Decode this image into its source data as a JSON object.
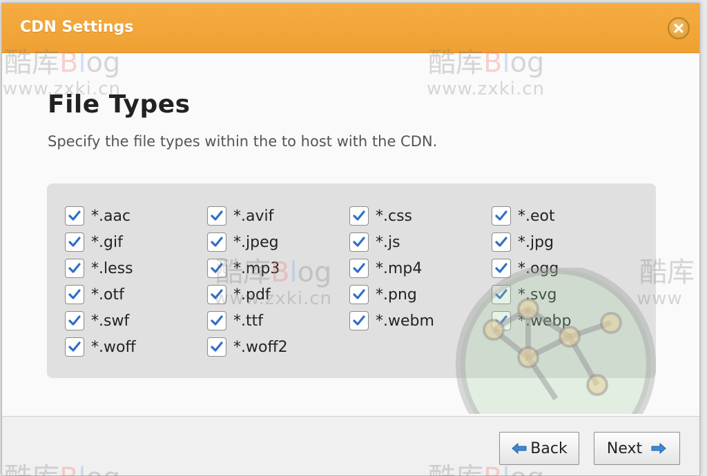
{
  "dialog": {
    "title": "CDN Settings",
    "close_icon": "close-icon"
  },
  "main": {
    "heading": "File Types",
    "description": "Specify the file types within the to host with the CDN."
  },
  "file_types": [
    {
      "label": "*.aac",
      "checked": true
    },
    {
      "label": "*.avif",
      "checked": true
    },
    {
      "label": "*.css",
      "checked": true
    },
    {
      "label": "*.eot",
      "checked": true
    },
    {
      "label": "*.gif",
      "checked": true
    },
    {
      "label": "*.jpeg",
      "checked": true
    },
    {
      "label": "*.js",
      "checked": true
    },
    {
      "label": "*.jpg",
      "checked": true
    },
    {
      "label": "*.less",
      "checked": true
    },
    {
      "label": "*.mp3",
      "checked": true
    },
    {
      "label": "*.mp4",
      "checked": true
    },
    {
      "label": "*.ogg",
      "checked": true
    },
    {
      "label": "*.otf",
      "checked": true
    },
    {
      "label": "*.pdf",
      "checked": true
    },
    {
      "label": "*.png",
      "checked": true
    },
    {
      "label": "*.svg",
      "checked": true
    },
    {
      "label": "*.swf",
      "checked": true
    },
    {
      "label": "*.ttf",
      "checked": true
    },
    {
      "label": "*.webm",
      "checked": true
    },
    {
      "label": "*.webp",
      "checked": true
    },
    {
      "label": "*.woff",
      "checked": true
    },
    {
      "label": "*.woff2",
      "checked": true
    }
  ],
  "footer": {
    "back_label": "Back",
    "next_label": "Next"
  },
  "watermark": {
    "title_part1": "酷库",
    "title_b": "B",
    "title_l": "l",
    "title_og": "og",
    "url": "www.zxki.cn"
  },
  "colors": {
    "titlebar": "#efa032",
    "check": "#2f6fc4",
    "arrow": "#3a8ad8"
  }
}
